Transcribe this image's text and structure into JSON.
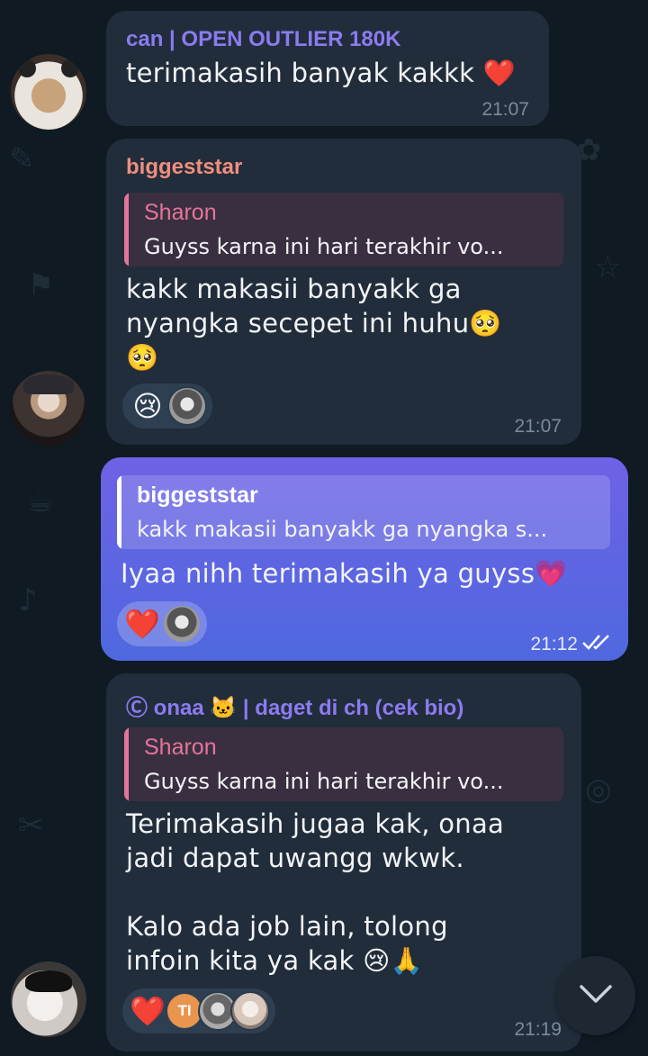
{
  "messages": [
    {
      "sender": "can | OPEN OUTLIER 180K",
      "sender_color": "#8b7bf0",
      "text": "terimakasih banyak kakkk ❤️",
      "time": "21:07"
    },
    {
      "sender": "biggeststar",
      "sender_color": "#f08e7e",
      "reply": {
        "name": "Sharon",
        "text": "Guyss karna ini hari terakhir vo...",
        "color": "#e4759a"
      },
      "text": "kakk makasii banyakk ga\nnyangka secepet ini huhu🥺\n🥺",
      "reactions": [
        "😢"
      ],
      "time": "21:07"
    },
    {
      "reply": {
        "name": "biggeststar",
        "text": "kakk makasii banyakk ga nyangka s...",
        "color": "#ffffff"
      },
      "text": "Iyaa nihh terimakasih ya guyss💗",
      "reactions": [
        "❤️"
      ],
      "time": "21:12",
      "status_icon": "double-check-icon"
    },
    {
      "sender": "Ⓒ onaa 🐱 | daget di ch (cek bio)",
      "sender_color": "#8b7bf0",
      "reply": {
        "name": "Sharon",
        "text": "Guyss karna ini hari terakhir vo...",
        "color": "#e4759a"
      },
      "text": "Terimakasih jugaa kak, onaa\njadi dapat uwangg wkwk.\n\nKalo ada job lain, tolong\ninfoin kita ya kak 😢🙏",
      "reactions": [
        "❤️"
      ],
      "reactor_initials": "TI",
      "time": "21:19"
    }
  ],
  "colors": {
    "background": "#0f1a22",
    "incoming_bubble": "#212d3b",
    "outgoing_bubble_top": "#6e62e5",
    "outgoing_bubble_bottom": "#4f68df"
  }
}
